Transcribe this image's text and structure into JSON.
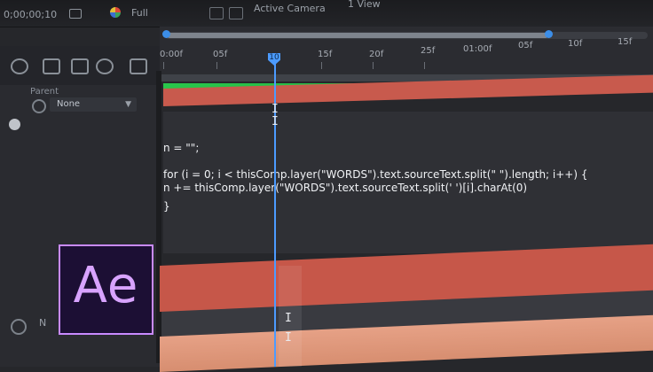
{
  "topbar": {
    "timecode": "0;00;00;10",
    "resolution": "Full",
    "camera": "Active Camera",
    "views": "1 View"
  },
  "ruler": {
    "ticks": [
      "0:00f",
      "05f",
      "10f",
      "15f",
      "20f",
      "25f",
      "01:00f",
      "05f",
      "10f",
      "15f"
    ],
    "playhead": "10"
  },
  "layers": {
    "parent_header": "Parent",
    "parent_value": "None",
    "lower_label": "N"
  },
  "code": {
    "lines": [
      "n = \"\";",
      "for (i = 0; i < thisComp.layer(\"WORDS\").text.sourceText.split(\" \").length; i++) {",
      "n += thisComp.layer(\"WORDS\").text.sourceText.split(' ')[i].charAt(0)",
      "}"
    ]
  },
  "logo": {
    "text": "Ae"
  },
  "colors": {
    "playhead": "#4c9bff",
    "work_area_green": "#28c64b",
    "layer_red": "#c85a4d",
    "logo_purple": "#d8a3ff"
  }
}
